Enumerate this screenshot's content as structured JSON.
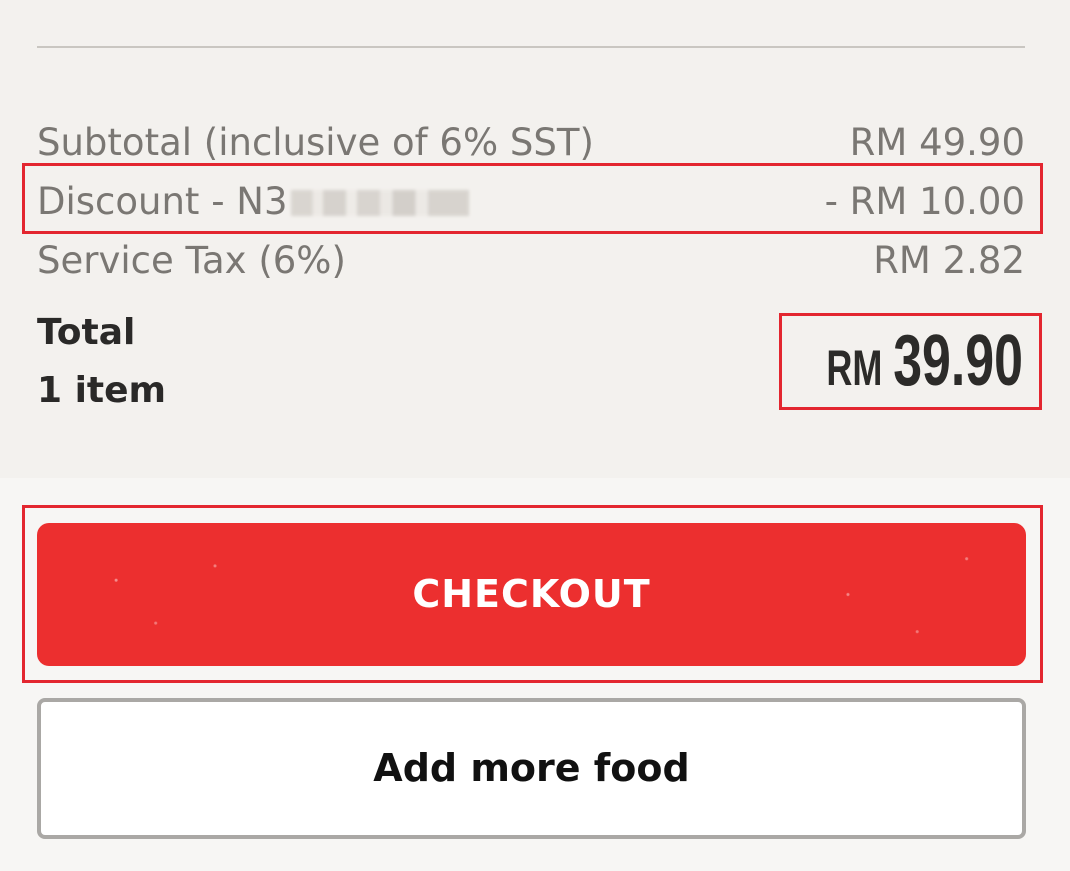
{
  "summary": {
    "subtotal_label": "Subtotal (inclusive of 6% SST)",
    "subtotal_value": "RM  49.90",
    "discount_label": "Discount - N3",
    "discount_value": "- RM  10.00",
    "service_tax_label": "Service Tax (6%)",
    "service_tax_value": "RM  2.82",
    "total_label": "Total",
    "item_count": "1 item",
    "total_currency": "RM",
    "total_amount": "39.90"
  },
  "actions": {
    "checkout_label": "CHECKOUT",
    "add_more_label": "Add more food"
  },
  "colors": {
    "accent": "#ec2f2f",
    "highlight": "#e3262f",
    "text_primary": "#2a2928",
    "text_secondary": "#7a7773"
  }
}
